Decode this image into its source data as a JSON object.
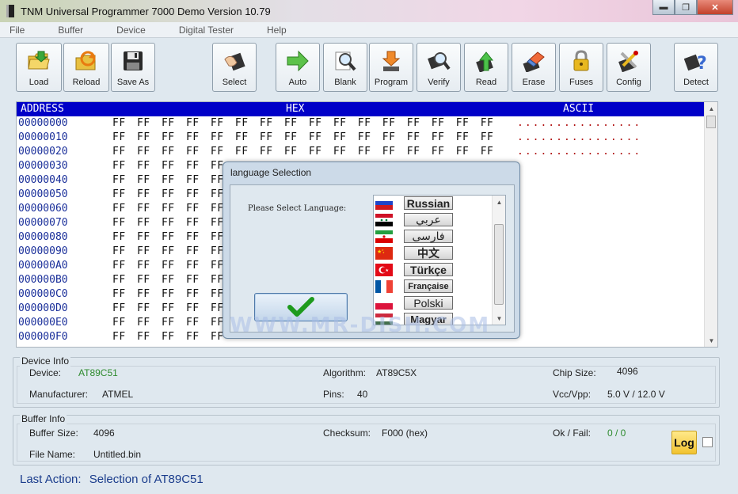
{
  "window": {
    "title": "TNM  Universal Programmer 7000 Demo   Version 10.79",
    "minimize": "▬",
    "maximize": "❐",
    "close": "✕"
  },
  "menu": [
    "File",
    "Buffer",
    "Device",
    "Digital Tester",
    "Help"
  ],
  "toolbar": [
    {
      "label": "Load",
      "icon": "load-folder-icon"
    },
    {
      "label": "Reload",
      "icon": "reload-icon"
    },
    {
      "label": "Save As",
      "icon": "floppy-disk-icon"
    },
    {
      "label": "Select",
      "icon": "select-chip-icon"
    },
    {
      "label": "Auto",
      "icon": "auto-arrow-icon"
    },
    {
      "label": "Blank",
      "icon": "blank-magnifier-icon"
    },
    {
      "label": "Program",
      "icon": "program-download-icon"
    },
    {
      "label": "Verify",
      "icon": "verify-magnifier-icon"
    },
    {
      "label": "Read",
      "icon": "read-upload-icon"
    },
    {
      "label": "Erase",
      "icon": "eraser-icon"
    },
    {
      "label": "Fuses",
      "icon": "lock-icon"
    },
    {
      "label": "Config",
      "icon": "tools-icon"
    },
    {
      "label": "Detect",
      "icon": "detect-question-icon"
    }
  ],
  "hex": {
    "header": {
      "address": "ADDRESS",
      "hex": "HEX",
      "ascii": "ASCII"
    },
    "rows": [
      {
        "addr": "00000000",
        "bytes": "FF FF FF FF FF FF FF FF FF FF FF FF FF FF FF FF",
        "ascii": "................"
      },
      {
        "addr": "00000010",
        "bytes": "FF FF FF FF FF FF FF FF FF FF FF FF FF FF FF FF",
        "ascii": "................"
      },
      {
        "addr": "00000020",
        "bytes": "FF FF FF FF FF FF FF FF FF FF FF FF FF FF FF FF",
        "ascii": "................"
      },
      {
        "addr": "00000030",
        "bytes": "FF FF FF FF FF",
        "ascii": ""
      },
      {
        "addr": "00000040",
        "bytes": "FF FF FF FF FF",
        "ascii": ""
      },
      {
        "addr": "00000050",
        "bytes": "FF FF FF FF FF",
        "ascii": ""
      },
      {
        "addr": "00000060",
        "bytes": "FF FF FF FF FF",
        "ascii": ""
      },
      {
        "addr": "00000070",
        "bytes": "FF FF FF FF FF",
        "ascii": ""
      },
      {
        "addr": "00000080",
        "bytes": "FF FF FF FF FF",
        "ascii": ""
      },
      {
        "addr": "00000090",
        "bytes": "FF FF FF FF FF",
        "ascii": ""
      },
      {
        "addr": "000000A0",
        "bytes": "FF FF FF FF FF",
        "ascii": ""
      },
      {
        "addr": "000000B0",
        "bytes": "FF FF FF FF FF",
        "ascii": ""
      },
      {
        "addr": "000000C0",
        "bytes": "FF FF FF FF FF",
        "ascii": ""
      },
      {
        "addr": "000000D0",
        "bytes": "FF FF FF FF FF",
        "ascii": ""
      },
      {
        "addr": "000000E0",
        "bytes": "FF FF FF FF FF",
        "ascii": ""
      },
      {
        "addr": "000000F0",
        "bytes": "FF FF FF FF FF",
        "ascii": ""
      }
    ]
  },
  "device_info": {
    "title": "Device Info",
    "device_label": "Device:",
    "device_value": "AT89C51",
    "algorithm_label": "Algorithm:",
    "algorithm_value": "AT89C5X",
    "chipsize_label": "Chip Size:",
    "chipsize_value": "4096",
    "manufacturer_label": "Manufacturer:",
    "manufacturer_value": "ATMEL",
    "pins_label": "Pins:",
    "pins_value": "40",
    "vcc_label": "Vcc/Vpp:",
    "vcc_value": "5.0 V / 12.0 V"
  },
  "buffer_info": {
    "title": "Buffer Info",
    "size_label": "Buffer Size:",
    "size_value": "4096",
    "checksum_label": "Checksum:",
    "checksum_value": "F000 (hex)",
    "okfail_label": "Ok / Fail:",
    "okfail_value": "0 / 0",
    "filename_label": "File Name:",
    "filename_value": "Untitled.bin",
    "log_label": "Log"
  },
  "last_action": {
    "label": "Last Action:",
    "value": "Selection of   AT89C51"
  },
  "dialog": {
    "title": "language Selection",
    "prompt": "Please Select Language:",
    "ok_icon": "green-checkmark-icon",
    "languages": [
      {
        "name": "Russian",
        "flag": "russia-flag-icon"
      },
      {
        "name": "عربي",
        "flag": "syria-flag-icon"
      },
      {
        "name": "فارسی",
        "flag": "iran-flag-icon"
      },
      {
        "name": "中文",
        "flag": "china-flag-icon"
      },
      {
        "name": "Türkçe",
        "flag": "turkey-flag-icon"
      },
      {
        "name": "Française",
        "flag": "france-flag-icon"
      },
      {
        "name": "Polski",
        "flag": "poland-flag-icon"
      },
      {
        "name": "Magyar",
        "flag": "hungary-flag-icon"
      }
    ]
  },
  "watermark": "WWW.MR-DISH.COM",
  "colors": {
    "hex_header_bg": "#0000c8",
    "address": "#1a2f9a",
    "ascii": "#b01010",
    "value_green": "#2e8b2e",
    "last_action": "#1a3c8c"
  }
}
